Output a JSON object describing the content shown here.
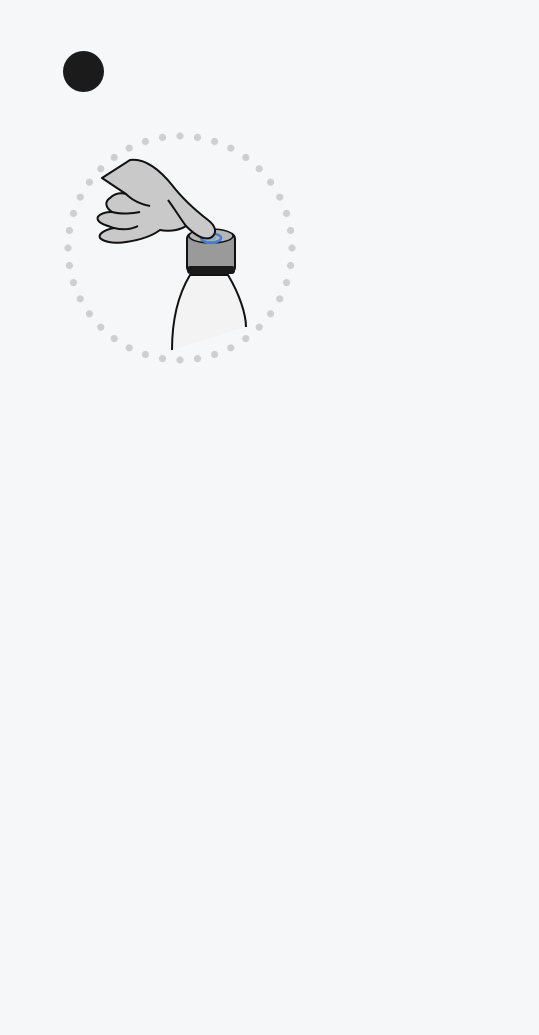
{
  "step": {
    "number": ""
  },
  "illustration": {
    "icon": "press-cap-button-illustration",
    "colors": {
      "dots": "#cfcfcf",
      "hand_fill": "#c9c9c9",
      "outline": "#111111",
      "cap_fill": "#9a9a9a",
      "button_ring": "#4a7fc9"
    }
  }
}
